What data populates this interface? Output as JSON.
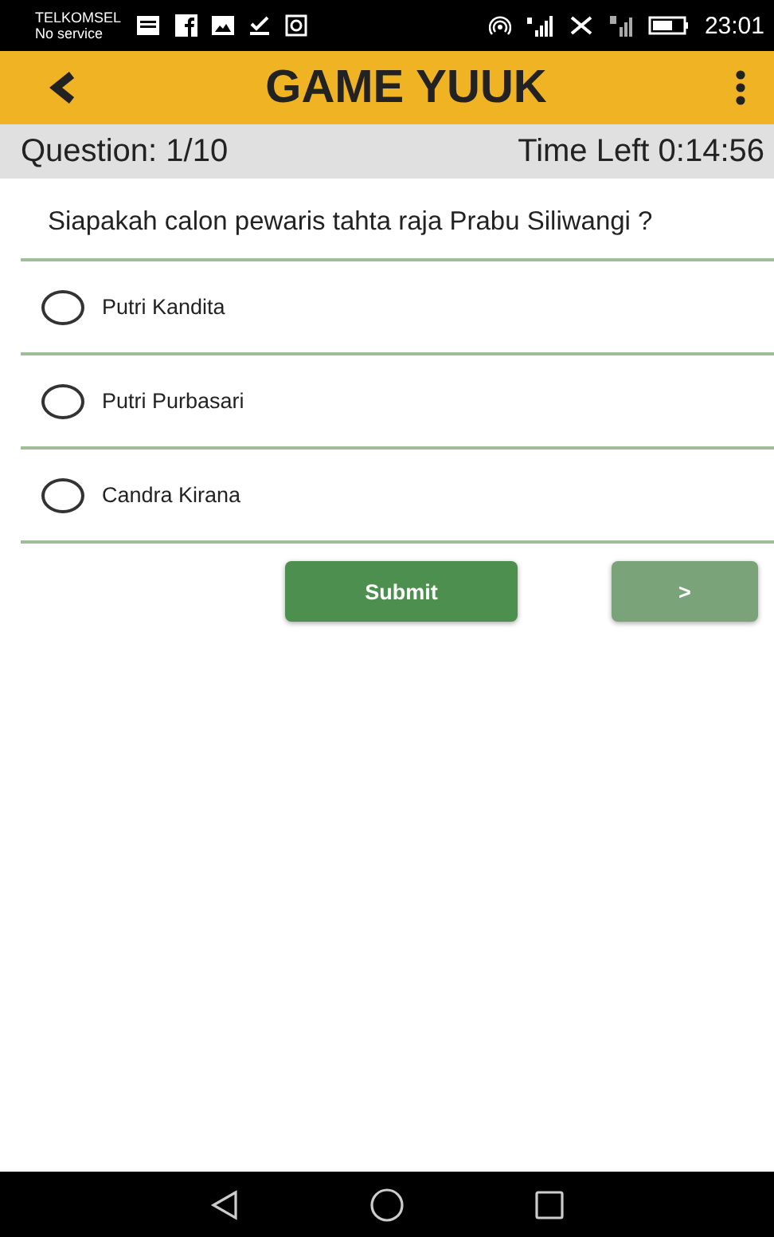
{
  "status_bar": {
    "carrier": "TELKOMSEL",
    "service": "No service",
    "time": "23:01"
  },
  "app_bar": {
    "title": "GAME YUUK"
  },
  "info_bar": {
    "question": "Question: 1/10",
    "time_left": "Time Left 0:14:56"
  },
  "question": "Siapakah calon pewaris tahta raja Prabu Siliwangi ?",
  "options": [
    {
      "label": "Putri Kandita",
      "selected": false
    },
    {
      "label": "Putri Purbasari",
      "selected": false
    },
    {
      "label": "Candra Kirana",
      "selected": false
    }
  ],
  "buttons": [
    {
      "label": "Submit",
      "disabled": false
    },
    {
      "label": ">",
      "disabled": true
    }
  ]
}
